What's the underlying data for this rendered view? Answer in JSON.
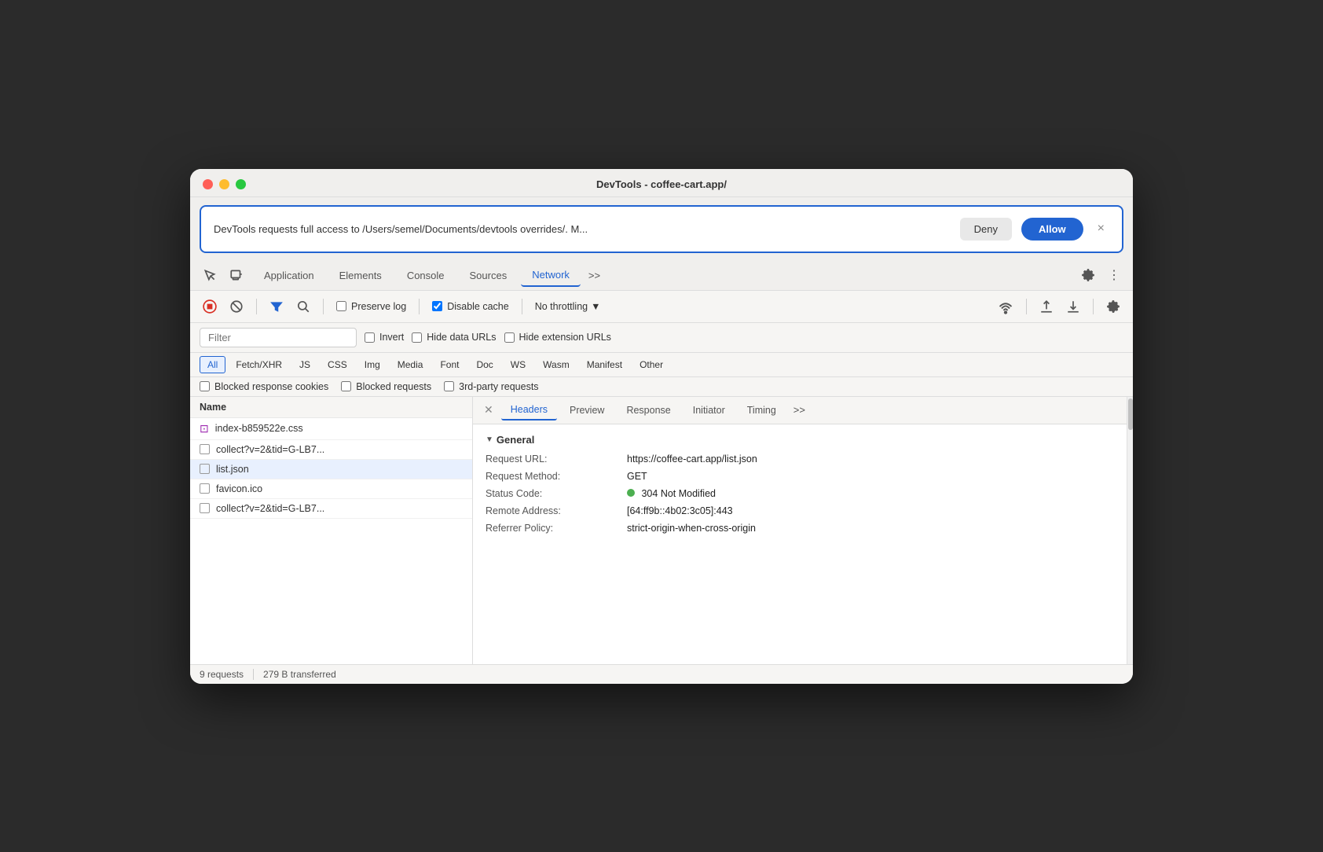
{
  "window": {
    "title": "DevTools - coffee-cart.app/"
  },
  "permission": {
    "text": "DevTools requests full access to /Users/semel/Documents/devtools overrides/. M...",
    "deny_label": "Deny",
    "allow_label": "Allow"
  },
  "tabs": [
    {
      "label": "Application",
      "active": false
    },
    {
      "label": "Elements",
      "active": false
    },
    {
      "label": "Console",
      "active": false
    },
    {
      "label": "Sources",
      "active": false
    },
    {
      "label": "Network",
      "active": true
    }
  ],
  "toolbar": {
    "preserve_log": "Preserve log",
    "disable_cache": "Disable cache",
    "no_throttling": "No throttling"
  },
  "filter": {
    "placeholder": "Filter",
    "invert_label": "Invert",
    "hide_data_label": "Hide data URLs",
    "hide_ext_label": "Hide extension URLs"
  },
  "type_filters": [
    {
      "label": "All",
      "active": true
    },
    {
      "label": "Fetch/XHR",
      "active": false
    },
    {
      "label": "JS",
      "active": false
    },
    {
      "label": "CSS",
      "active": false
    },
    {
      "label": "Img",
      "active": false
    },
    {
      "label": "Media",
      "active": false
    },
    {
      "label": "Font",
      "active": false
    },
    {
      "label": "Doc",
      "active": false
    },
    {
      "label": "WS",
      "active": false
    },
    {
      "label": "Wasm",
      "active": false
    },
    {
      "label": "Manifest",
      "active": false
    },
    {
      "label": "Other",
      "active": false
    }
  ],
  "blocked": {
    "blocked_cookies": "Blocked response cookies",
    "blocked_requests": "Blocked requests",
    "third_party": "3rd-party requests"
  },
  "request_list": {
    "header": "Name",
    "items": [
      {
        "name": "index-b859522e.css",
        "type": "css",
        "selected": false
      },
      {
        "name": "collect?v=2&tid=G-LB7...",
        "type": "other",
        "selected": false
      },
      {
        "name": "list.json",
        "type": "json",
        "selected": true
      },
      {
        "name": "favicon.ico",
        "type": "ico",
        "selected": false
      },
      {
        "name": "collect?v=2&tid=G-LB7...",
        "type": "other",
        "selected": false
      }
    ]
  },
  "detail_tabs": [
    {
      "label": "Headers",
      "active": true
    },
    {
      "label": "Preview",
      "active": false
    },
    {
      "label": "Response",
      "active": false
    },
    {
      "label": "Initiator",
      "active": false
    },
    {
      "label": "Timing",
      "active": false
    }
  ],
  "general_section": {
    "title": "General",
    "fields": [
      {
        "label": "Request URL:",
        "value": "https://coffee-cart.app/list.json"
      },
      {
        "label": "Request Method:",
        "value": "GET"
      },
      {
        "label": "Status Code:",
        "value": "304 Not Modified",
        "has_dot": true
      },
      {
        "label": "Remote Address:",
        "value": "[64:ff9b::4b02:3c05]:443"
      },
      {
        "label": "Referrer Policy:",
        "value": "strict-origin-when-cross-origin"
      }
    ]
  },
  "statusbar": {
    "requests": "9 requests",
    "transferred": "279 B transferred"
  }
}
